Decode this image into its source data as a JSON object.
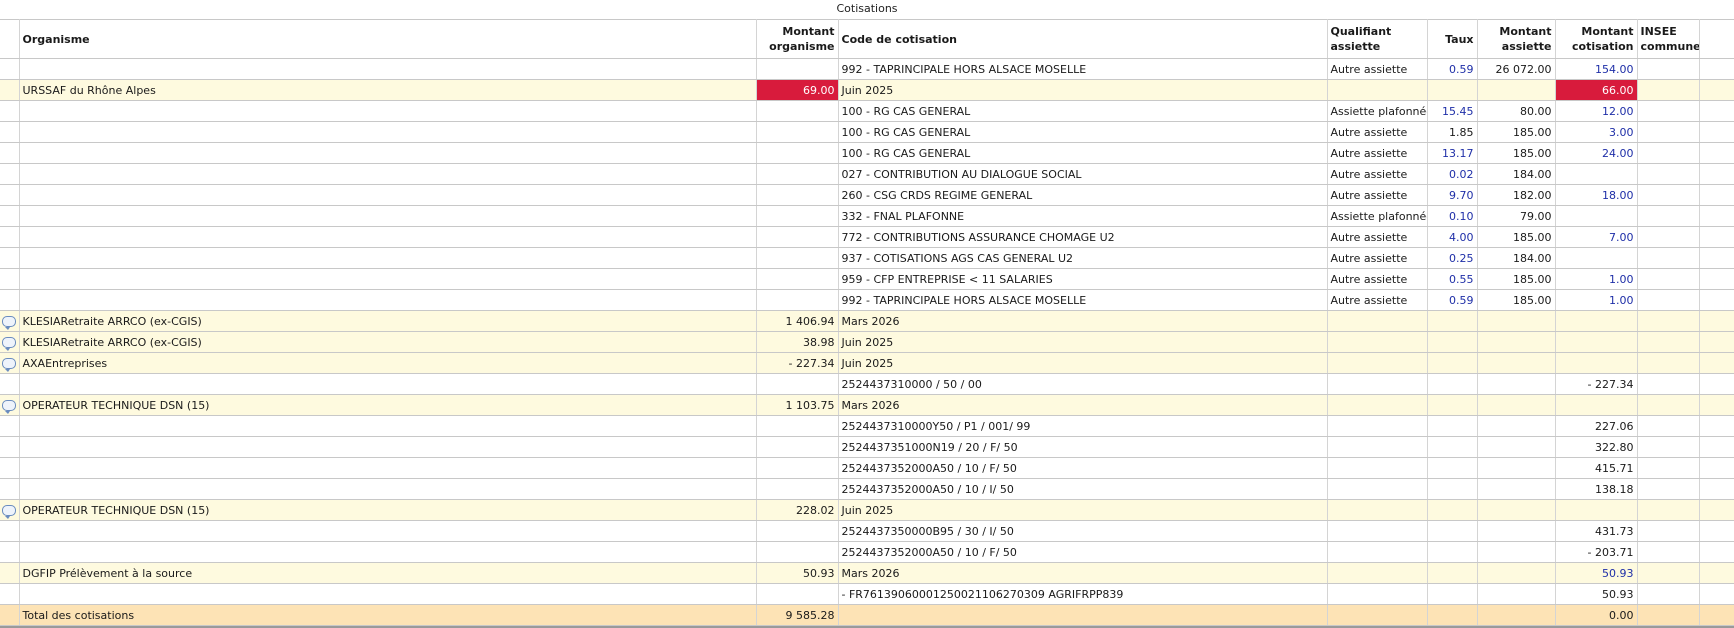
{
  "caption": "Cotisations",
  "headers": {
    "organisme": "Organisme",
    "montant_organisme": "Montant organisme",
    "code": "Code de cotisation",
    "qualifiant": "Qualifiant assiette",
    "taux": "Taux",
    "montant_assiette": "Montant assiette",
    "montant_cotisation": "Montant cotisation",
    "insee": "INSEE commune"
  },
  "rows": [
    {
      "kind": "line",
      "icon": false,
      "org": "",
      "mo": "",
      "code": "992 - TAPRINCIPALE HORS ALSACE MOSELLE",
      "qual": "Autre assiette",
      "taux": "0.59",
      "taux_blue": true,
      "ass": "26 072.00",
      "cot": "154.00",
      "cot_blue": true,
      "cot_red": false,
      "mo_red": false
    },
    {
      "kind": "org",
      "icon": false,
      "org": "URSSAF du Rhône Alpes",
      "mo": "69.00",
      "mo_red": true,
      "code": "Juin 2025",
      "qual": "",
      "taux": "",
      "ass": "",
      "cot": "66.00",
      "cot_red": true,
      "cot_blue": false
    },
    {
      "kind": "line",
      "icon": false,
      "org": "",
      "mo": "",
      "code": "100 - RG CAS GENERAL",
      "qual": "Assiette plafonnée",
      "taux": "15.45",
      "taux_blue": true,
      "ass": "80.00",
      "cot": "12.00",
      "cot_blue": true
    },
    {
      "kind": "line",
      "icon": false,
      "org": "",
      "mo": "",
      "code": "100 - RG CAS GENERAL",
      "qual": "Autre assiette",
      "taux": "1.85",
      "taux_blue": false,
      "ass": "185.00",
      "cot": "3.00",
      "cot_blue": true
    },
    {
      "kind": "line",
      "icon": false,
      "org": "",
      "mo": "",
      "code": "100 - RG CAS GENERAL",
      "qual": "Autre assiette",
      "taux": "13.17",
      "taux_blue": true,
      "ass": "185.00",
      "cot": "24.00",
      "cot_blue": true
    },
    {
      "kind": "line",
      "icon": false,
      "org": "",
      "mo": "",
      "code": "027 - CONTRIBUTION AU DIALOGUE SOCIAL",
      "qual": "Autre assiette",
      "taux": "0.02",
      "taux_blue": true,
      "ass": "184.00",
      "cot": "",
      "cot_blue": false
    },
    {
      "kind": "line",
      "icon": false,
      "org": "",
      "mo": "",
      "code": "260 - CSG CRDS REGIME GENERAL",
      "qual": "Autre assiette",
      "taux": "9.70",
      "taux_blue": true,
      "ass": "182.00",
      "cot": "18.00",
      "cot_blue": true
    },
    {
      "kind": "line",
      "icon": false,
      "org": "",
      "mo": "",
      "code": "332 - FNAL PLAFONNE",
      "qual": "Assiette plafonnée",
      "taux": "0.10",
      "taux_blue": true,
      "ass": "79.00",
      "cot": "",
      "cot_blue": false
    },
    {
      "kind": "line",
      "icon": false,
      "org": "",
      "mo": "",
      "code": "772 - CONTRIBUTIONS ASSURANCE CHOMAGE U2",
      "qual": "Autre assiette",
      "taux": "4.00",
      "taux_blue": true,
      "ass": "185.00",
      "cot": "7.00",
      "cot_blue": true
    },
    {
      "kind": "line",
      "icon": false,
      "org": "",
      "mo": "",
      "code": "937 - COTISATIONS AGS CAS GENERAL U2",
      "qual": "Autre assiette",
      "taux": "0.25",
      "taux_blue": true,
      "ass": "184.00",
      "cot": "",
      "cot_blue": false
    },
    {
      "kind": "line",
      "icon": false,
      "org": "",
      "mo": "",
      "code": "959 - CFP ENTREPRISE < 11 SALARIES",
      "qual": "Autre assiette",
      "taux": "0.55",
      "taux_blue": true,
      "ass": "185.00",
      "cot": "1.00",
      "cot_blue": true
    },
    {
      "kind": "line",
      "icon": false,
      "org": "",
      "mo": "",
      "code": "992 - TAPRINCIPALE HORS ALSACE MOSELLE",
      "qual": "Autre assiette",
      "taux": "0.59",
      "taux_blue": true,
      "ass": "185.00",
      "cot": "1.00",
      "cot_blue": true
    },
    {
      "kind": "org",
      "icon": true,
      "org": "KLESIARetraite ARRCO (ex-CGIS)",
      "mo": "1 406.94",
      "code": "Mars 2026",
      "qual": "",
      "taux": "",
      "ass": "",
      "cot": ""
    },
    {
      "kind": "org",
      "icon": true,
      "org": "KLESIARetraite ARRCO (ex-CGIS)",
      "mo": "38.98",
      "code": "Juin 2025",
      "qual": "",
      "taux": "",
      "ass": "",
      "cot": ""
    },
    {
      "kind": "org",
      "icon": true,
      "org": "AXAEntreprises",
      "mo": "- 227.34",
      "code": "Juin 2025",
      "qual": "",
      "taux": "",
      "ass": "",
      "cot": ""
    },
    {
      "kind": "line",
      "icon": false,
      "org": "",
      "mo": "",
      "code": "2524437310000 / 50 / 00",
      "qual": "",
      "taux": "",
      "ass": "",
      "cot": "- 227.34"
    },
    {
      "kind": "org",
      "icon": true,
      "org": "OPERATEUR TECHNIQUE DSN (15)",
      "mo": "1 103.75",
      "code": "Mars 2026",
      "qual": "",
      "taux": "",
      "ass": "",
      "cot": ""
    },
    {
      "kind": "line",
      "icon": false,
      "org": "",
      "mo": "",
      "code": "2524437310000Y50 / P1 / 001/ 99",
      "qual": "",
      "taux": "",
      "ass": "",
      "cot": "227.06"
    },
    {
      "kind": "line",
      "icon": false,
      "org": "",
      "mo": "",
      "code": "2524437351000N19 / 20 / F/ 50",
      "qual": "",
      "taux": "",
      "ass": "",
      "cot": "322.80"
    },
    {
      "kind": "line",
      "icon": false,
      "org": "",
      "mo": "",
      "code": "2524437352000A50 / 10 / F/ 50",
      "qual": "",
      "taux": "",
      "ass": "",
      "cot": "415.71"
    },
    {
      "kind": "line",
      "icon": false,
      "org": "",
      "mo": "",
      "code": "2524437352000A50 / 10 / I/ 50",
      "qual": "",
      "taux": "",
      "ass": "",
      "cot": "138.18"
    },
    {
      "kind": "org",
      "icon": true,
      "org": "OPERATEUR TECHNIQUE DSN (15)",
      "mo": "228.02",
      "code": "Juin 2025",
      "qual": "",
      "taux": "",
      "ass": "",
      "cot": ""
    },
    {
      "kind": "line",
      "icon": false,
      "org": "",
      "mo": "",
      "code": "2524437350000B95 / 30 / I/ 50",
      "qual": "",
      "taux": "",
      "ass": "",
      "cot": "431.73"
    },
    {
      "kind": "line",
      "icon": false,
      "org": "",
      "mo": "",
      "code": "2524437352000A50 / 10 / F/ 50",
      "qual": "",
      "taux": "",
      "ass": "",
      "cot": "- 203.71"
    },
    {
      "kind": "org",
      "icon": false,
      "org": "DGFIP Prélèvement à la source",
      "mo": "50.93",
      "code": "Mars 2026",
      "qual": "",
      "taux": "",
      "ass": "",
      "cot": "50.93",
      "cot_blue": true
    },
    {
      "kind": "line",
      "icon": false,
      "org": "",
      "mo": "",
      "code": " - FR7613906000125002110627030​9 AGRIFRPP839",
      "qual": "",
      "taux": "",
      "ass": "",
      "cot": "50.93"
    },
    {
      "kind": "total",
      "icon": false,
      "org": "Total des cotisations",
      "mo": "9 585.28",
      "code": "",
      "qual": "",
      "taux": "",
      "ass": "",
      "cot": "0.00"
    }
  ]
}
